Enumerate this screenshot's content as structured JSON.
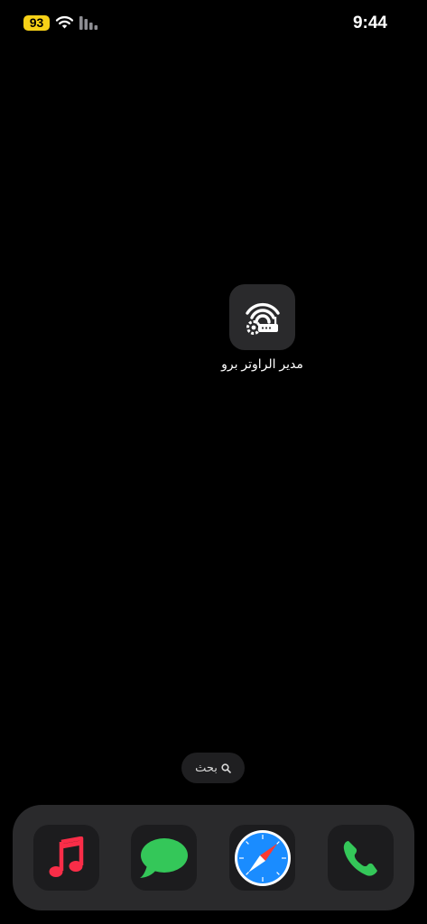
{
  "status_bar": {
    "battery_level": "93",
    "time": "9:44",
    "wifi_icon": "wifi-icon",
    "signal_icon": "cellular-signal-icon"
  },
  "home": {
    "apps": [
      {
        "label": "مدير الراوتر برو",
        "icon": "router-gear-wifi-icon"
      }
    ]
  },
  "search": {
    "label": "بحث",
    "icon": "magnifying-glass-icon"
  },
  "dock": {
    "apps": [
      {
        "icon": "music-icon",
        "accent": "#fa2d48"
      },
      {
        "icon": "messages-icon",
        "accent": "#34c759"
      },
      {
        "icon": "safari-icon",
        "accent": "#1a8cff"
      },
      {
        "icon": "phone-icon",
        "accent": "#34c759"
      }
    ]
  },
  "colors": {
    "background": "#000000",
    "battery_badge": "#f7d117",
    "dock": "#2a2a2c"
  }
}
